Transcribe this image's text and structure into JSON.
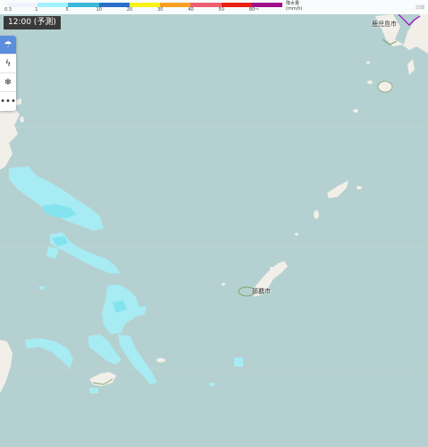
{
  "legend": {
    "colors": [
      "#f2f2ff",
      "#a0f0ff",
      "#3ab8d8",
      "#2a6fc8",
      "#f7f21a",
      "#f5a020",
      "#ee6070",
      "#e82010",
      "#a0108c"
    ],
    "ticks": [
      "0.3",
      "1",
      "5",
      "10",
      "20",
      "30",
      "40",
      "50",
      "80〜"
    ],
    "unit_line1": "降水量",
    "unit_line2": "(mm/h)"
  },
  "time_badge": "12:00 (予測)",
  "toolbar": {
    "items": [
      {
        "name": "rain-cloud-icon",
        "glyph": "☂",
        "active": true
      },
      {
        "name": "lightning-icon",
        "glyph": "ϟ",
        "active": false
      },
      {
        "name": "snow-icon",
        "glyph": "❄",
        "active": false
      },
      {
        "name": "more-icon",
        "glyph": "•••",
        "active": false
      }
    ]
  },
  "cities": {
    "kagoshima": "鹿児島市",
    "naha": "那覇市"
  },
  "corner_label": "詳細",
  "colors": {
    "sea": "#b5d0d0",
    "land": "#f2efe9",
    "rain_light": "#a7edf5",
    "rain_mid": "#7fe3ef",
    "boundary": "#a000c8",
    "coast_green": "#79a86a"
  }
}
